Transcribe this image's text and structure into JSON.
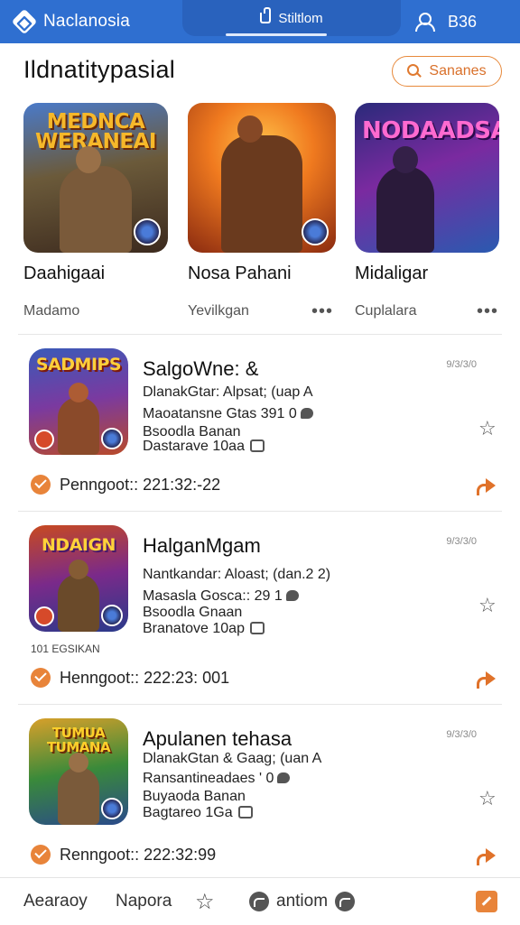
{
  "topbar": {
    "app_name": "Naclanosia",
    "center_label": "Stiltlom",
    "right_label": "B36",
    "colors": {
      "bar": "#2f6fd0",
      "tab": "#2962bd"
    }
  },
  "section": {
    "title": "Ildnatitypasial",
    "search_label": "Sananes"
  },
  "featured": [
    {
      "logo": "MEDNCA WERANEAI",
      "name": "Daahigaai",
      "sub": "Madamo"
    },
    {
      "logo": "",
      "name": "Nosa Pahani",
      "sub": "Yevilkgan"
    },
    {
      "logo": "NODAADSA",
      "name": "Midaligar",
      "sub": "Cuplalara"
    }
  ],
  "cards": [
    {
      "logo": "SADMIPS",
      "title": "SalgoWne: &",
      "date": "9/3/3/0",
      "line1": "DlanakGtar: Alpsat; (uap",
      "line1_tail": "A",
      "line2": "Maoatansne Gtas 391 0",
      "line3": "Bsoodla Banan",
      "line4": "Dastarave 10aa",
      "status": "Penngoot:: 221:32:-22"
    },
    {
      "logo": "NDAIGN",
      "title": "HalganMgam",
      "date": "9/3/3/0",
      "line1": "Nantkandar: Aloast; (dan.2 2)",
      "line1_tail": "",
      "line2": "Masasla Gosca:: 29 1",
      "line3": "Bsoodla Gnaan",
      "line4": "Branatove 10ap",
      "status": "Henngoot:: 222:23: 001"
    },
    {
      "logo": "TUMUA TUMANA",
      "title": "Apulanen tehasa",
      "date": "9/3/3/0",
      "line1": "DlanakGtan & Gaag; (uan",
      "line1_tail": "A",
      "line2": "Ransantineadaes ' 0",
      "line3": "Buyaoda Banan",
      "line4": "Bagtareo 1Ga",
      "status": "Renngoot:: 222:32:99"
    }
  ],
  "side_label": "101 EGSIKAN",
  "bottom_nav": {
    "item1": "Aearaoy",
    "item2": "Napora",
    "item3": "antiom"
  }
}
